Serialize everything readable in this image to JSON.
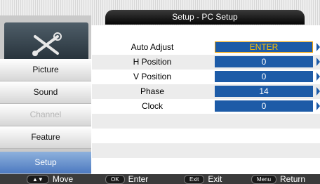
{
  "title": "Setup - PC Setup",
  "sidebar": {
    "items": [
      {
        "label": "Picture",
        "state": "normal"
      },
      {
        "label": "Sound",
        "state": "normal"
      },
      {
        "label": "Channel",
        "state": "disabled"
      },
      {
        "label": "Feature",
        "state": "normal"
      },
      {
        "label": "Setup",
        "state": "active"
      }
    ]
  },
  "menu": {
    "rows": [
      {
        "label": "Auto Adjust",
        "value": "ENTER"
      },
      {
        "label": "H Position",
        "value": "0"
      },
      {
        "label": "V Position",
        "value": "0"
      },
      {
        "label": "Phase",
        "value": "14"
      },
      {
        "label": "Clock",
        "value": "0"
      }
    ]
  },
  "footer": {
    "hints": [
      {
        "key": "▲▼",
        "action": "Move"
      },
      {
        "key": "OK",
        "action": "Enter"
      },
      {
        "key": "Exit",
        "action": "Exit"
      },
      {
        "key": "Menu",
        "action": "Return"
      }
    ]
  },
  "colors": {
    "accent": "#1d5ba7",
    "selected_border": "#f2a200",
    "selected_text": "#ffc000",
    "active_sidebar": "#4d79c0"
  },
  "icons": {
    "tool": "setup-tools-icon",
    "arrow": "arrow-right-icon"
  }
}
